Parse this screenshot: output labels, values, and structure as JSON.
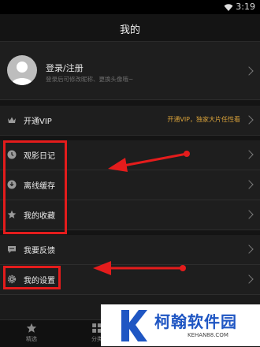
{
  "status_bar": {
    "time": "3:19",
    "wifi_icon": "wifi-icon"
  },
  "header": {
    "title": "我的"
  },
  "login": {
    "title": "登录/注册",
    "subtitle": "登录后可修改昵称、更换头像哦~",
    "avatar_icon": "user-avatar-icon"
  },
  "menu": {
    "vip": {
      "label": "开通VIP",
      "hint": "开通VIP，独家大片任性看",
      "icon": "crown-icon"
    },
    "diary": {
      "label": "观影日记",
      "icon": "clock-icon"
    },
    "offline": {
      "label": "离线缓存",
      "icon": "download-icon"
    },
    "favorites": {
      "label": "我的收藏",
      "icon": "star-icon"
    },
    "feedback": {
      "label": "我要反馈",
      "icon": "chat-bubble-icon"
    },
    "settings": {
      "label": "我的设置",
      "icon": "gear-icon"
    }
  },
  "tab_bar": {
    "tabs": [
      {
        "label": "精选",
        "icon": "star-icon"
      },
      {
        "label": "分类",
        "icon": "grid-icon"
      }
    ]
  },
  "watermark": {
    "text": "柯翰软件园",
    "url": "KEHAN88.COM"
  },
  "colors": {
    "background": "#1b1b1b",
    "accent": "#d9a23a",
    "annotation": "#e41c1c",
    "watermark": "#1f56c3"
  }
}
